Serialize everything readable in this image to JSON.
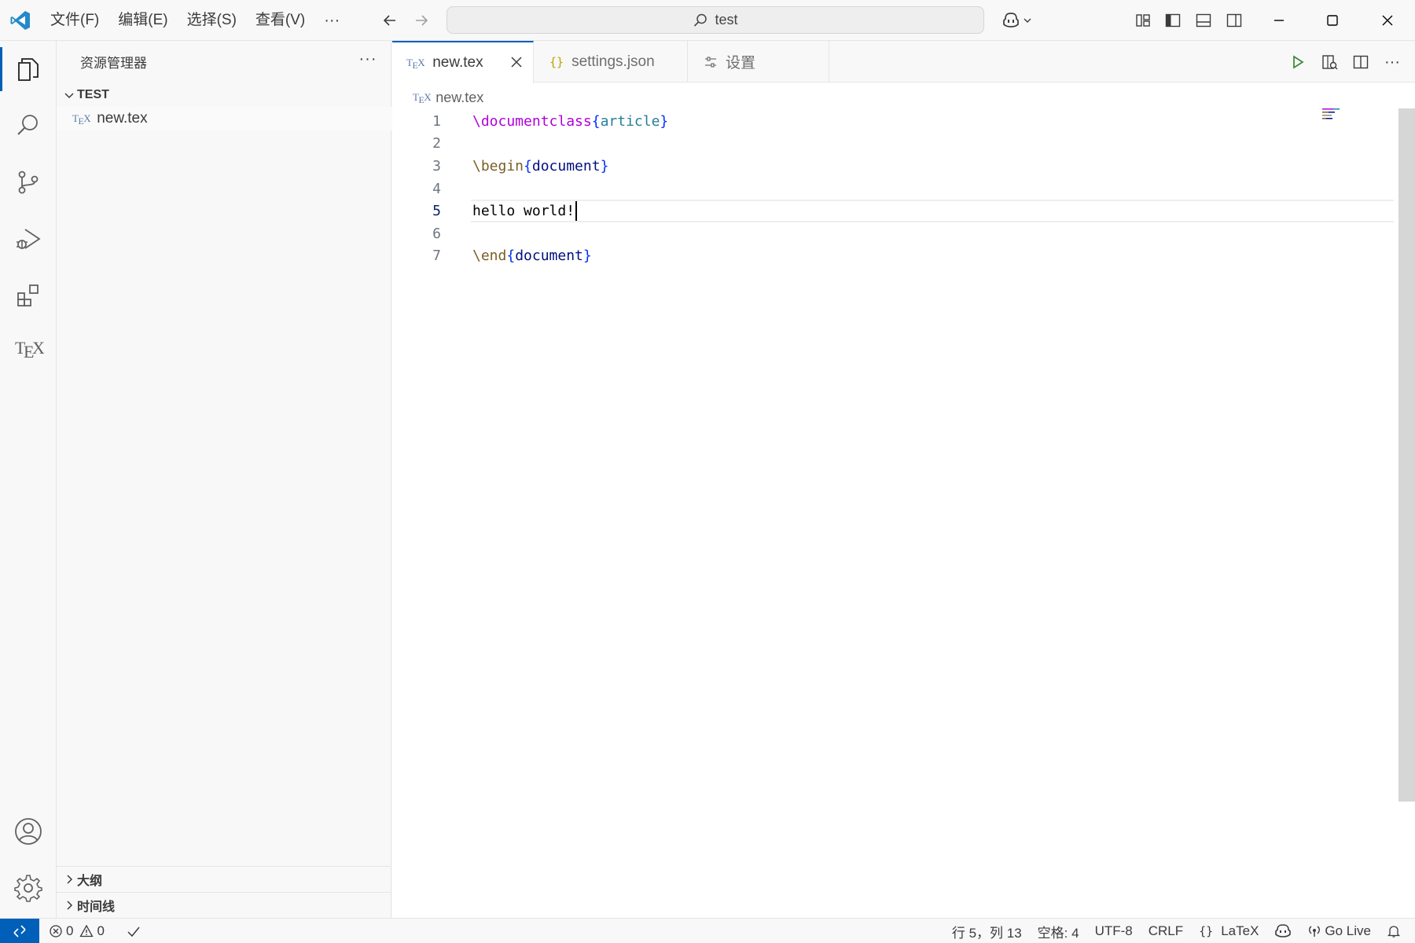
{
  "titlebar": {
    "menus": [
      "文件(F)",
      "编辑(E)",
      "选择(S)",
      "查看(V)"
    ],
    "more": "···",
    "search_text": "test"
  },
  "sidebar": {
    "title": "资源管理器",
    "more": "···",
    "folder": "TEST",
    "files": [
      {
        "name": "new.tex",
        "icon": "tex-file-icon"
      }
    ],
    "sections": [
      "大纲",
      "时间线"
    ]
  },
  "tabs": [
    {
      "label": "new.tex",
      "icon": "tex-file-icon",
      "active": true
    },
    {
      "label": "settings.json",
      "icon": "json-file-icon",
      "active": false
    },
    {
      "label": "设置",
      "icon": "settings-sliders-icon",
      "active": false
    }
  ],
  "breadcrumb": {
    "file": "new.tex"
  },
  "editor": {
    "current_line": 5,
    "lines": [
      {
        "n": "1",
        "text": "\\documentclass{article}"
      },
      {
        "n": "2",
        "text": ""
      },
      {
        "n": "3",
        "text": "\\begin{document}"
      },
      {
        "n": "4",
        "text": ""
      },
      {
        "n": "5",
        "text": "hello world!"
      },
      {
        "n": "6",
        "text": ""
      },
      {
        "n": "7",
        "text": "\\end{document}"
      }
    ]
  },
  "statusbar": {
    "errors": "0",
    "warnings": "0",
    "cursor_position": "行 5，列 13",
    "indent": "空格: 4",
    "encoding": "UTF-8",
    "eol": "CRLF",
    "language": "LaTeX",
    "go_live": "Go Live"
  },
  "colors": {
    "accent": "#005fb8",
    "latex_command": "#af00db",
    "latex_env_command": "#795e26",
    "latex_brace": "#0431fa",
    "latex_arg": "#267f99"
  }
}
